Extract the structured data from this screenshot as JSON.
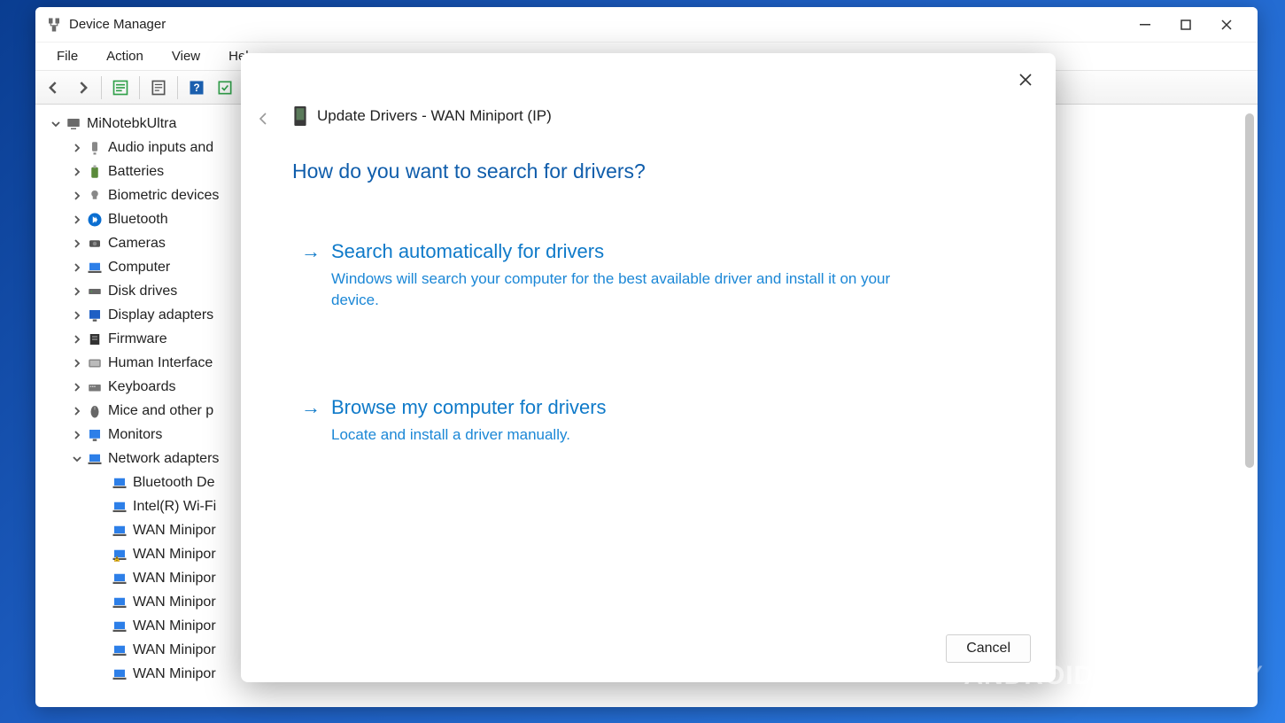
{
  "window": {
    "title": "Device Manager"
  },
  "menubar": {
    "file": "File",
    "action": "Action",
    "view": "View",
    "help": "Help"
  },
  "tree": {
    "root": "MiNotebkUltra",
    "categories": [
      "Audio inputs and",
      "Batteries",
      "Biometric devices",
      "Bluetooth",
      "Cameras",
      "Computer",
      "Disk drives",
      "Display adapters",
      "Firmware",
      "Human Interface",
      "Keyboards",
      "Mice and other p",
      "Monitors",
      "Network adapters"
    ],
    "network_children": [
      "Bluetooth De",
      "Intel(R) Wi-Fi",
      "WAN Minipor",
      "WAN Minipor",
      "WAN Minipor",
      "WAN Minipor",
      "WAN Minipor",
      "WAN Minipor",
      "WAN Minipor"
    ]
  },
  "dialog": {
    "title": "Update Drivers - WAN Miniport (IP)",
    "question": "How do you want to search for drivers?",
    "option1_title": "Search automatically for drivers",
    "option1_desc": "Windows will search your computer for the best available driver and install it on your device.",
    "option2_title": "Browse my computer for drivers",
    "option2_desc": "Locate and install a driver manually.",
    "cancel": "Cancel"
  },
  "watermark": {
    "brand": "ANDROID",
    "suffix": "AUTHORITY"
  }
}
